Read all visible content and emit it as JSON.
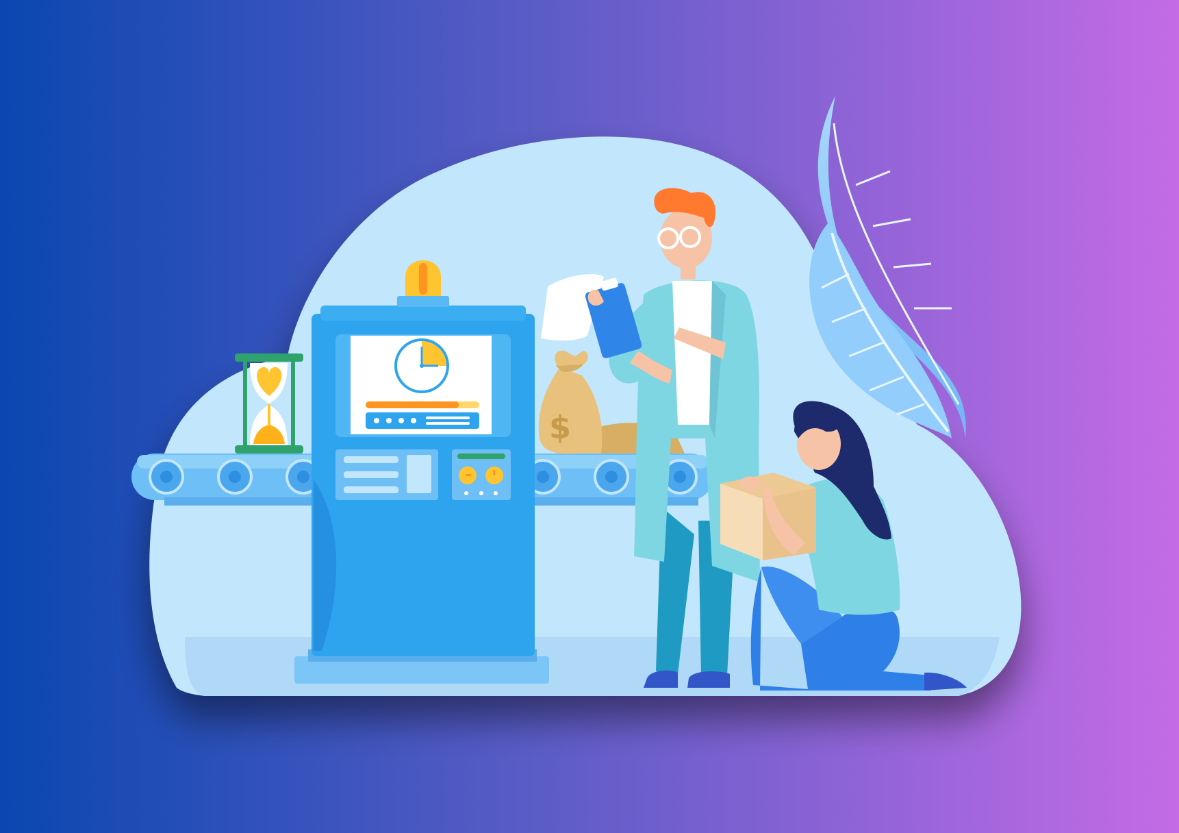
{
  "palette": {
    "bg_left": "#0A47B0",
    "bg_mid": "#5A5CC6",
    "bg_right": "#C46BE6",
    "cloud": "#C2E6FC",
    "cloud_floor": "#AFD9F6",
    "machine": "#2FA4EE",
    "machine_dark": "#1E7FD6",
    "conveyor": "#6EBFF5",
    "accent_yellow": "#FFC531",
    "accent_orange": "#FF9421",
    "skin": "#F7C3A6",
    "hair_man": "#FF7A2F",
    "hair_woman": "#1D2A6B",
    "coat": "#7ED6E3",
    "jeans": "#2F7FE8",
    "box": "#F6DDB7",
    "sack": "#E8C27C",
    "leaf": "#8FCBFA"
  },
  "icons": [
    "hourglass-icon",
    "clock-icon",
    "alarm-light-icon",
    "money-bag-icon",
    "dollar-sign-icon",
    "clipboard-icon",
    "cardboard-box-icon",
    "leaf-icon"
  ],
  "objects": {
    "machine": "processing-machine",
    "conveyor": "conveyor-belt",
    "man": "worker-with-clipboard",
    "woman": "worker-with-box"
  },
  "machine_screen": {
    "progress": 0.82,
    "clock_fraction_filled": 0.25
  }
}
